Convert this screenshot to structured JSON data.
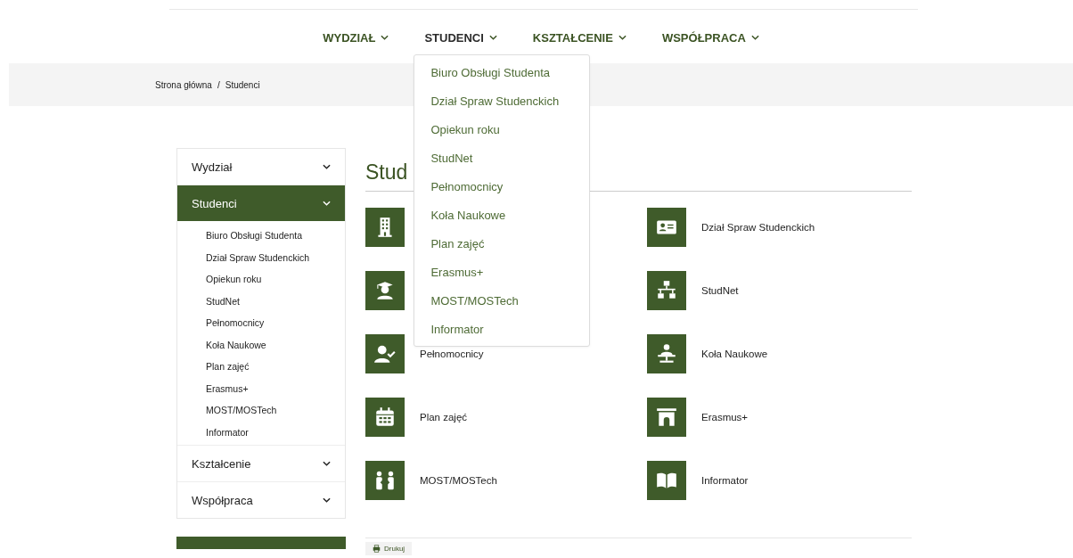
{
  "nav": [
    {
      "label": "WYDZIAŁ",
      "expanded": false
    },
    {
      "label": "STUDENCI",
      "expanded": true,
      "menu": [
        "Biuro Obsługi Studenta",
        "Dział Spraw Studenckich",
        "Opiekun roku",
        "StudNet",
        "Pełnomocnicy",
        "Koła Naukowe",
        "Plan zajęć",
        "Erasmus+",
        "MOST/MOSTech",
        "Informator"
      ]
    },
    {
      "label": "KSZTAŁCENIE",
      "expanded": false
    },
    {
      "label": "WSPÓŁPRACA",
      "expanded": false
    }
  ],
  "breadcrumb": {
    "separator": "/",
    "items": [
      "Strona główna",
      "Studenci"
    ]
  },
  "sidebar": {
    "items": [
      {
        "label": "Wydział",
        "selected": false
      },
      {
        "label": "Studenci",
        "selected": true,
        "children": [
          "Biuro Obsługi Studenta",
          "Dział Spraw Studenckich",
          "Opiekun roku",
          "StudNet",
          "Pełnomocnicy",
          "Koła Naukowe",
          "Plan zajęć",
          "Erasmus+",
          "MOST/MOSTech",
          "Informator"
        ]
      },
      {
        "label": "Kształcenie",
        "selected": false
      },
      {
        "label": "Współpraca",
        "selected": false
      }
    ]
  },
  "page": {
    "title": "Stud",
    "tiles": [
      {
        "kind": "icon_only"
      },
      {
        "kind": "labeled",
        "label": "Dział Spraw Studenckich"
      },
      {
        "kind": "icon_only"
      },
      {
        "kind": "labeled",
        "label": "StudNet"
      },
      {
        "kind": "labeled",
        "label": "Pełnomocnicy"
      },
      {
        "kind": "labeled",
        "label": "Koła Naukowe"
      },
      {
        "kind": "labeled",
        "label": "Plan zajęć"
      },
      {
        "kind": "labeled",
        "label": "Erasmus+"
      },
      {
        "kind": "labeled",
        "label": "MOST/MOSTech"
      },
      {
        "kind": "labeled",
        "label": "Informator"
      }
    ],
    "print_label": "Drukuj"
  }
}
